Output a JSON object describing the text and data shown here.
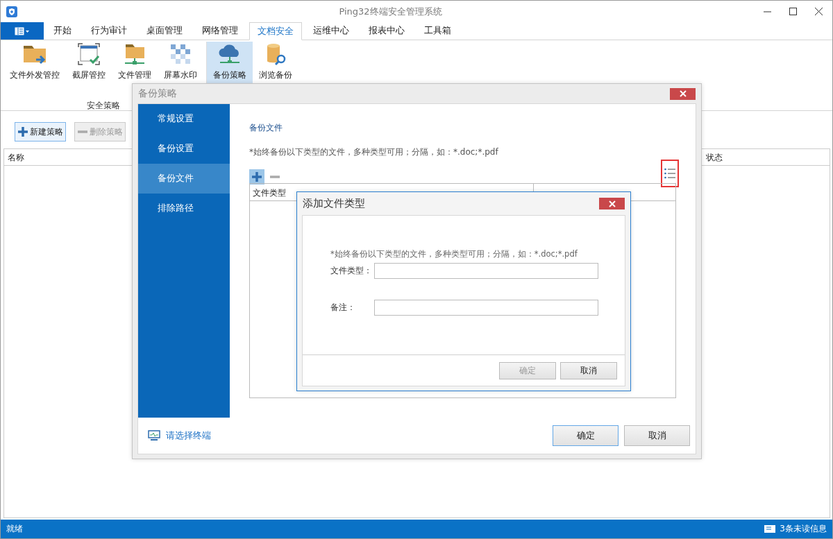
{
  "window": {
    "title": "Ping32终端安全管理系统"
  },
  "tabs": [
    {
      "label": "开始",
      "selected": false
    },
    {
      "label": "行为审计",
      "selected": false
    },
    {
      "label": "桌面管理",
      "selected": false
    },
    {
      "label": "网络管理",
      "selected": false
    },
    {
      "label": "文档安全",
      "selected": true
    },
    {
      "label": "运维中心",
      "selected": false
    },
    {
      "label": "报表中心",
      "selected": false
    },
    {
      "label": "工具箱",
      "selected": false
    }
  ],
  "ribbon": {
    "group_label": "安全策略",
    "buttons": [
      {
        "label": "文件外发管控",
        "kind": "folder-send",
        "selected": false
      },
      {
        "label": "截屏管控",
        "kind": "screenshot",
        "selected": false
      },
      {
        "label": "文件管理",
        "kind": "folder-net",
        "selected": false
      },
      {
        "label": "屏幕水印",
        "kind": "watermark",
        "selected": false
      },
      {
        "label": "备份策略",
        "kind": "cloud",
        "selected": true
      },
      {
        "label": "浏览备份",
        "kind": "database",
        "selected": false
      }
    ]
  },
  "toolbar": [
    {
      "label": "新建策略",
      "kind": "add",
      "disabled": false
    },
    {
      "label": "删除策略",
      "kind": "remove",
      "disabled": true
    }
  ],
  "table": {
    "columns": [
      "名称",
      "状态"
    ]
  },
  "policy_dialog": {
    "title": "备份策略",
    "nav": [
      {
        "label": "常规设置",
        "selected": false
      },
      {
        "label": "备份设置",
        "selected": false
      },
      {
        "label": "备份文件",
        "selected": true
      },
      {
        "label": "排除路径",
        "selected": false
      }
    ],
    "section_title": "备份文件",
    "hint": "*始终备份以下类型的文件，多种类型可用；分隔，如：*.doc;*.pdf",
    "list_tools": [
      {
        "kind": "add",
        "selected": true
      },
      {
        "kind": "remove",
        "selected": false
      }
    ],
    "view_toggle": {
      "highlighted": true
    },
    "file_table": {
      "columns": [
        "文件类型"
      ]
    },
    "terminal_link": "请选择终端",
    "buttons": [
      {
        "label": "确定",
        "focused": true
      },
      {
        "label": "取消",
        "focused": false
      }
    ]
  },
  "add_dialog": {
    "title": "添加文件类型",
    "hint": "*始终备份以下类型的文件，多种类型可用；分隔，如：*.doc;*.pdf",
    "fields": [
      {
        "label": "文件类型："
      },
      {
        "label": "备注："
      }
    ],
    "buttons": [
      {
        "label": "确定",
        "disabled": true
      },
      {
        "label": "取消",
        "disabled": false
      }
    ]
  },
  "status_bar": {
    "text": "就绪",
    "messages": "3条未读信息"
  }
}
